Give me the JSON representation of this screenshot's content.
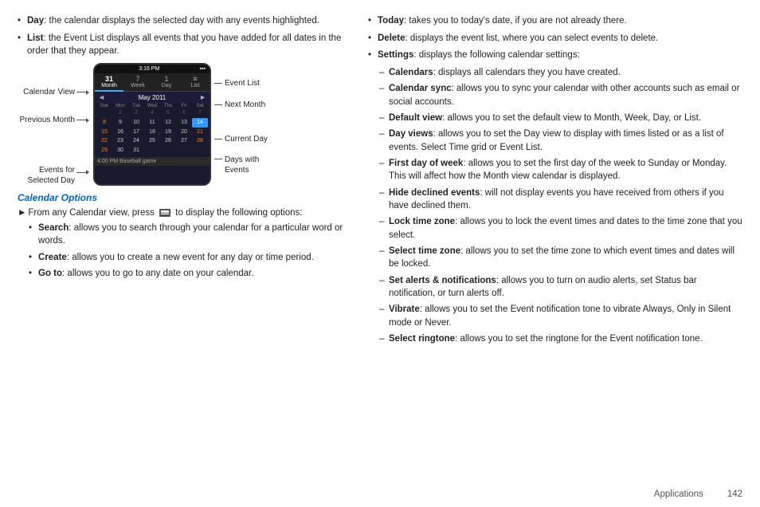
{
  "left": {
    "bullets": [
      {
        "label": "Day",
        "text": ": the calendar displays the selected day with any events highlighted."
      },
      {
        "label": "List",
        "text": ": the Event List displays all events that you have added for all dates in the order that they appear."
      }
    ],
    "diagram": {
      "left_labels": [
        {
          "id": "calendar-view",
          "text": "Calendar View"
        },
        {
          "id": "previous-month",
          "text": "Previous Month"
        },
        {
          "id": "events-for-selected-day",
          "text": "Events for\nSelected Day"
        }
      ],
      "right_labels": [
        {
          "id": "event-list",
          "text": "Event List"
        },
        {
          "id": "next-month",
          "text": "Next Month"
        },
        {
          "id": "current-day",
          "text": "Current Day"
        },
        {
          "id": "days-with-events",
          "text": "Days with\nEvents"
        }
      ],
      "phone": {
        "status": "3:16 PM",
        "month": "May 2011",
        "tabs": [
          "31",
          "7",
          "1",
          "≡"
        ],
        "tab_labels": [
          "Month",
          "Week",
          "Day",
          "List"
        ],
        "day_headers": [
          "Sun",
          "Mon",
          "Tue",
          "Wed",
          "Thu",
          "Fri",
          "Sat"
        ],
        "weeks": [
          [
            " ",
            " ",
            " ",
            " ",
            " ",
            "  6",
            " "
          ],
          [
            "8",
            "9",
            "10",
            "11",
            "12",
            "13",
            "14"
          ],
          [
            "15",
            "16",
            "17",
            "18",
            "19",
            "20",
            "21"
          ],
          [
            "22",
            "23",
            "24",
            "25",
            "26",
            "27",
            "28"
          ],
          [
            "29",
            "30",
            "31",
            " ",
            " ",
            " ",
            " "
          ]
        ],
        "event": "4:00 PM  Baseball game"
      }
    },
    "options_title": "Calendar Options",
    "option_intro": "From any Calendar view, press",
    "option_intro2": "to display the following options:",
    "sub_bullets": [
      {
        "label": "Search",
        "text": ": allows you to search through your calendar for a particular word or words."
      },
      {
        "label": "Create",
        "text": ": allows you to create a new event for any day or time period."
      },
      {
        "label": "Go to",
        "text": ": allows you to go to any date on your calendar."
      }
    ]
  },
  "right": {
    "bullets": [
      {
        "label": "Today",
        "text": ": takes you to today's date, if you are not already there."
      },
      {
        "label": "Delete",
        "text": ": displays the event list, where you can select events to delete."
      },
      {
        "label": "Settings",
        "text": ": displays the following calendar settings:"
      }
    ],
    "dash_items": [
      {
        "label": "Calendars",
        "text": ": displays all calendars they you have created."
      },
      {
        "label": "Calendar sync",
        "text": ": allows you to sync your calendar with other accounts such as email or social accounts."
      },
      {
        "label": "Default view",
        "text": ": allows you to set the default view to Month, Week, Day, or List."
      },
      {
        "label": "Day views",
        "text": ": allows you to set the Day view to display with times listed or as a list of events. Select Time grid or Event List."
      },
      {
        "label": "First day of week",
        "text": ": allows you to set the first day of the week to Sunday or Monday. This will affect how the Month view calendar is displayed."
      },
      {
        "label": "Hide declined events",
        "text": ": will not display events you have received from others if you have declined them."
      },
      {
        "label": "Lock time zone",
        "text": ": allows you to lock the event times and dates to the time zone that you select."
      },
      {
        "label": "Select time zone",
        "text": ": allows you to set the time zone to which event times and dates will be locked."
      },
      {
        "label": "Set alerts & notifications",
        "text": ": allows you to turn on audio alerts, set Status bar notification, or turn alerts off."
      },
      {
        "label": "Vibrate",
        "text": ": allows you to set the Event notification tone to vibrate Always, Only in Silent mode or Never."
      },
      {
        "label": "Select ringtone",
        "text": ": allows you to set the ringtone for the Event notification tone."
      }
    ]
  },
  "footer": {
    "section": "Applications",
    "page": "142"
  }
}
